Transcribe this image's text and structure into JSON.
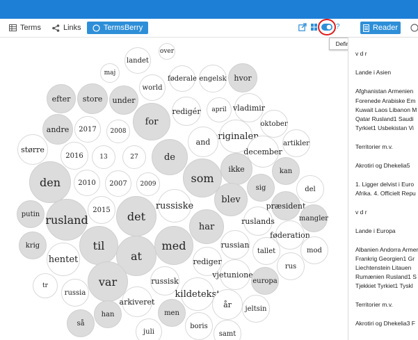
{
  "toolbar": {
    "terms_label": "Terms",
    "links_label": "Links",
    "termsberry_label": "TermsBerry",
    "reader_label": "Reader",
    "tooltip": "Define options for this tool."
  },
  "colors": {
    "topbar": "#1e7fd6",
    "accent": "#2e8fd8",
    "highlight": "#e01b1b",
    "bubble_grey": "#dcdcdc"
  },
  "bubbles": [
    {
      "word": "over",
      "grey": false
    },
    {
      "word": "landet",
      "grey": false
    },
    {
      "word": "maj",
      "grey": false
    },
    {
      "word": "føderale",
      "grey": false
    },
    {
      "word": "engelsk",
      "grey": false
    },
    {
      "word": "hvor",
      "grey": true
    },
    {
      "word": "world",
      "grey": false
    },
    {
      "word": "efter",
      "grey": true
    },
    {
      "word": "store",
      "grey": true
    },
    {
      "word": "under",
      "grey": true
    },
    {
      "word": "redigér",
      "grey": false
    },
    {
      "word": "april",
      "grey": false
    },
    {
      "word": "vladimir",
      "grey": false
    },
    {
      "word": "for",
      "grey": true
    },
    {
      "word": "andre",
      "grey": true
    },
    {
      "word": "2017",
      "grey": false
    },
    {
      "word": "2008",
      "grey": false
    },
    {
      "word": "oktober",
      "grey": false
    },
    {
      "word": "originalen",
      "grey": false
    },
    {
      "word": "større",
      "grey": false
    },
    {
      "word": "and",
      "grey": false
    },
    {
      "word": "artikler",
      "grey": false
    },
    {
      "word": "2016",
      "grey": false
    },
    {
      "word": "13",
      "grey": false
    },
    {
      "word": "27",
      "grey": false
    },
    {
      "word": "de",
      "grey": true
    },
    {
      "word": "december",
      "grey": false
    },
    {
      "word": "ikke",
      "grey": true
    },
    {
      "word": "kan",
      "grey": true
    },
    {
      "word": "den",
      "grey": true
    },
    {
      "word": "2010",
      "grey": false
    },
    {
      "word": "2007",
      "grey": false
    },
    {
      "word": "2009",
      "grey": false
    },
    {
      "word": "som",
      "grey": true
    },
    {
      "word": "sig",
      "grey": true
    },
    {
      "word": "del",
      "grey": false
    },
    {
      "word": "russiske",
      "grey": false
    },
    {
      "word": "blev",
      "grey": true
    },
    {
      "word": "putin",
      "grey": true
    },
    {
      "word": "2015",
      "grey": false
    },
    {
      "word": "rusland",
      "grey": true
    },
    {
      "word": "det",
      "grey": true
    },
    {
      "word": "præsident",
      "grey": true
    },
    {
      "word": "ruslands",
      "grey": false
    },
    {
      "word": "mangler",
      "grey": true
    },
    {
      "word": "har",
      "grey": true
    },
    {
      "word": "føderation",
      "grey": false
    },
    {
      "word": "krig",
      "grey": true
    },
    {
      "word": "til",
      "grey": true
    },
    {
      "word": "med",
      "grey": true
    },
    {
      "word": "russian",
      "grey": false
    },
    {
      "word": "hentet",
      "grey": false
    },
    {
      "word": "at",
      "grey": true
    },
    {
      "word": "tallet",
      "grey": false
    },
    {
      "word": "mod",
      "grey": false
    },
    {
      "word": "rediger",
      "grey": false
    },
    {
      "word": "vjetunionen",
      "grey": false
    },
    {
      "word": "rus",
      "grey": false
    },
    {
      "word": "var",
      "grey": true
    },
    {
      "word": "russisk",
      "grey": false
    },
    {
      "word": "europa",
      "grey": true
    },
    {
      "word": "tr",
      "grey": false
    },
    {
      "word": "russia",
      "grey": false
    },
    {
      "word": "kildetekst",
      "grey": false
    },
    {
      "word": "arkiveret",
      "grey": false
    },
    {
      "word": "år",
      "grey": false
    },
    {
      "word": "jeltsin",
      "grey": false
    },
    {
      "word": "han",
      "grey": true
    },
    {
      "word": "men",
      "grey": true
    },
    {
      "word": "så",
      "grey": true
    },
    {
      "word": "juli",
      "grey": false
    },
    {
      "word": "boris",
      "grey": false
    },
    {
      "word": "samt",
      "grey": false
    }
  ],
  "reader_lines": [
    "v d r",
    "Lande i Asien",
    "Afghanistan Armenien",
    "Forenede Arabiske Em",
    "Kuwait Laos Libanon M",
    "Qatar Rusland1 Saudi",
    "Tyrkiet1 Usbekistan Vi",
    "Territorier m.v.",
    "Akrotiri og Dhekelia5",
    "1. Ligger delvist i Euro",
    "Afrika. 4. Officielt Repu",
    "v d r",
    "Lande i Europa",
    "Albanien Andorra Armen",
    "Frankrig Georgien1 Gr",
    "Liechtenstein Litauen",
    "Rumænien Rusland1 S",
    "Tjekkiet Tyrkiet1 Tyskl",
    "Territorier m.v.",
    "Akrotiri og Dhekelia3 F"
  ]
}
